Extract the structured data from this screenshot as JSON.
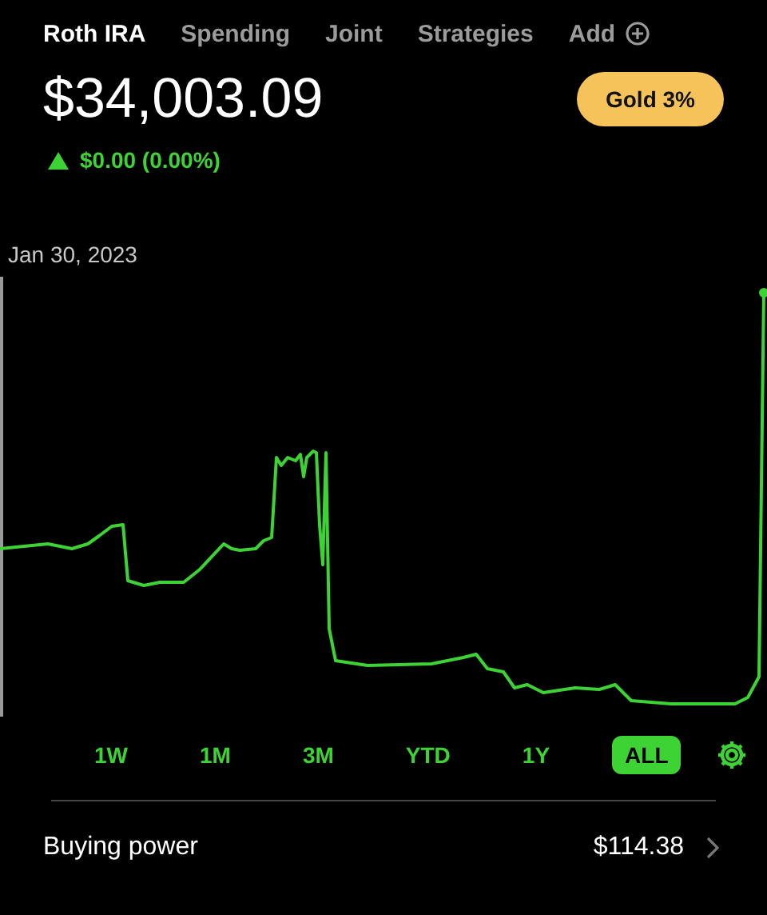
{
  "tabs": [
    {
      "label": "Roth IRA",
      "selected": true
    },
    {
      "label": "Spending",
      "selected": false
    },
    {
      "label": "Joint",
      "selected": false
    },
    {
      "label": "Strategies",
      "selected": false
    },
    {
      "label": "Add",
      "selected": false,
      "kind": "add"
    }
  ],
  "balance": "$34,003.09",
  "badge": "Gold 3%",
  "change": {
    "rising": true,
    "text": "$0.00 (0.00%)"
  },
  "date_label": "Jan 30, 2023",
  "ranges": [
    {
      "label": "1W",
      "selected": false
    },
    {
      "label": "1M",
      "selected": false
    },
    {
      "label": "3M",
      "selected": false
    },
    {
      "label": "YTD",
      "selected": false
    },
    {
      "label": "1Y",
      "selected": false
    },
    {
      "label": "ALL",
      "selected": true
    }
  ],
  "row": {
    "label": "Buying power",
    "value": "$114.38"
  }
}
